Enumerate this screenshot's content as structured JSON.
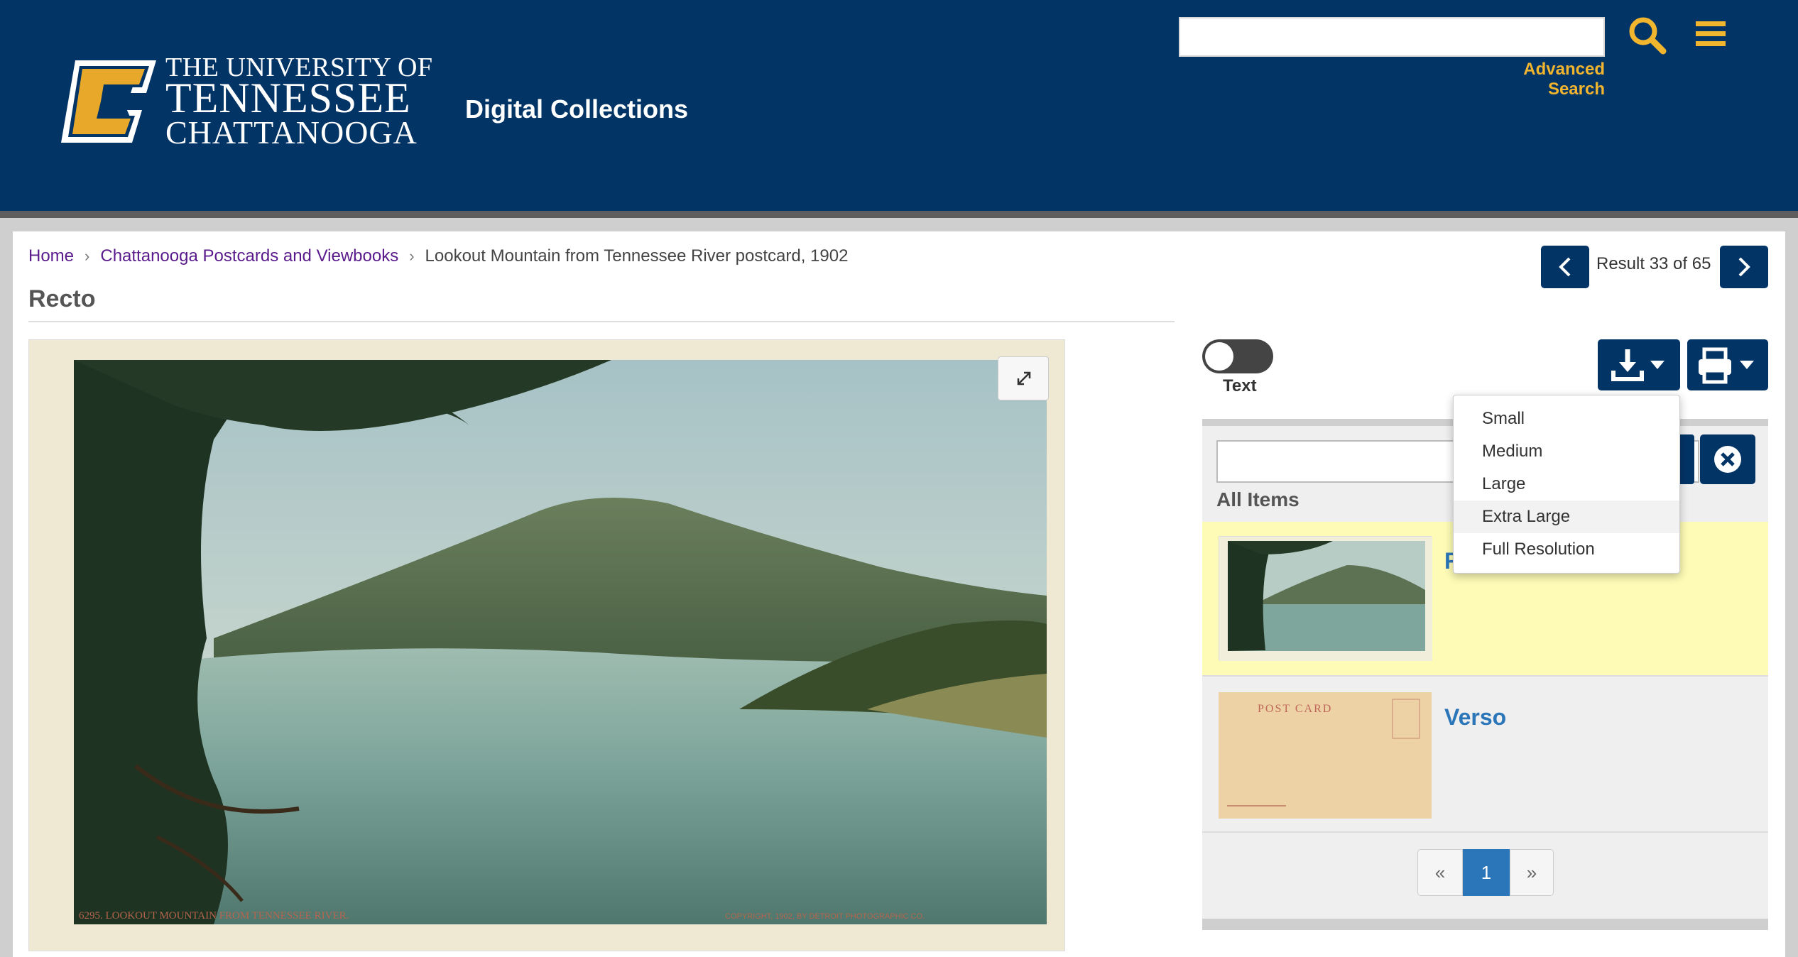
{
  "header": {
    "logo_lines": [
      "THE UNIVERSITY OF",
      "TENNESSEE",
      "CHATTANOOGA"
    ],
    "site_title": "Digital Collections",
    "search_value": "",
    "advanced_search": "Advanced Search",
    "search_icon": "search-icon",
    "menu_icon": "hamburger-menu-icon"
  },
  "breadcrumb": {
    "items": [
      "Home",
      "Chattanooga Postcards and Viewbooks",
      "Lookout Mountain from Tennessee River postcard, 1902"
    ]
  },
  "page_title": "Recto",
  "pagination_result": "Result 33 of 65",
  "image": {
    "caption_left": "6295. LOOKOUT MOUNTAIN FROM TENNESSEE RIVER.",
    "caption_right": "COPYRIGHT, 1902, BY DETROIT PHOTOGRAPHIC CO."
  },
  "toggle": {
    "label": "Text",
    "on": false
  },
  "download_menu": {
    "items": [
      "Small",
      "Medium",
      "Large",
      "Extra Large",
      "Full Resolution"
    ],
    "hovered": "Extra Large"
  },
  "sidebar": {
    "filter_value": "",
    "heading": "All Items",
    "items": [
      {
        "title": "Recto",
        "visible_title": "R",
        "selected": true
      },
      {
        "title": "Verso",
        "visible_title": "Verso",
        "selected": false,
        "thumb_text": "POST CARD"
      }
    ],
    "pager": {
      "prev": "«",
      "current": "1",
      "next": "»"
    }
  },
  "colors": {
    "header_bg": "#033466",
    "accent_gold": "#f1b52e",
    "link_blue": "#2b76b9",
    "selected_item_bg": "#fdfbb5"
  }
}
